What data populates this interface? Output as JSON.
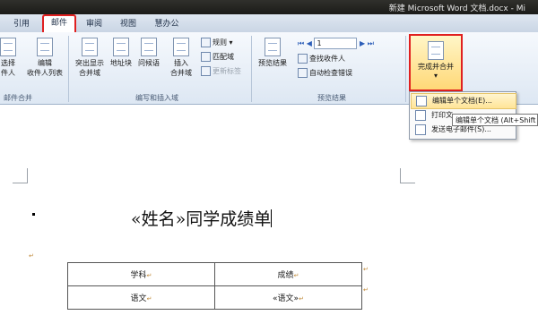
{
  "window": {
    "title": "新建 Microsoft Word 文档.docx - Mi"
  },
  "tabs": [
    {
      "label": "引用"
    },
    {
      "label": "邮件",
      "active": true
    },
    {
      "label": "审阅"
    },
    {
      "label": "视图"
    },
    {
      "label": "慧办公"
    }
  ],
  "ribbon": {
    "start_group": {
      "label": "邮件合并",
      "select_label_1": "选择",
      "select_label_2": "件人",
      "edit_label_1": "编辑",
      "edit_label_2": "收件人列表"
    },
    "write_group": {
      "label": "编写和插入域",
      "highlight_label_1": "突出显示",
      "highlight_label_2": "合并域",
      "address_label": "地址块",
      "greeting_label": "问候语",
      "insert_label_1": "插入",
      "insert_label_2": "合并域",
      "rules_label": "规则",
      "match_label": "匹配域",
      "update_label": "更新标签"
    },
    "preview_group": {
      "label": "预览结果",
      "preview_label": "预览结果",
      "record_value": "1",
      "find_label": "查找收件人",
      "check_label": "自动检查错误"
    },
    "finish": {
      "label": "完成并合并"
    }
  },
  "menu": {
    "items": [
      {
        "label": "编辑单个文档(E)..."
      },
      {
        "label": "打印文"
      },
      {
        "label": "发送电子邮件(S)..."
      }
    ]
  },
  "tooltip": {
    "text": "编辑单个文档 (Alt+Shift"
  },
  "document": {
    "heading": "«姓名»同学成绩单",
    "table": {
      "rows": [
        [
          "学科",
          "成绩"
        ],
        [
          "语文",
          "«语文»"
        ]
      ]
    }
  },
  "colors": {
    "highlight_red": "#e02020",
    "finish_fill": "#ffd877"
  }
}
